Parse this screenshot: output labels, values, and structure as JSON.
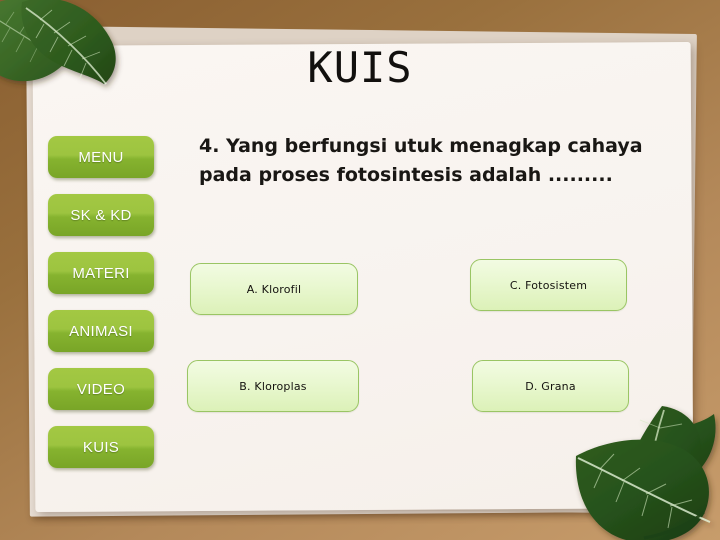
{
  "slide": {
    "title": "KUIS",
    "background_color": "#99703d",
    "paper_color": "#f8f3ef"
  },
  "sidebar": {
    "accent_color": "#8fbb36",
    "items": [
      {
        "label": "MENU",
        "name": "menu"
      },
      {
        "label": "SK & KD",
        "name": "sk-kd"
      },
      {
        "label": "MATERI",
        "name": "materi"
      },
      {
        "label": "ANIMASI",
        "name": "animasi"
      },
      {
        "label": "VIDEO",
        "name": "video"
      },
      {
        "label": "KUIS",
        "name": "kuis"
      }
    ]
  },
  "quiz": {
    "question_line_1": "4. Yang berfungsi utuk menagkap cahaya",
    "question_line_2": "pada proses fotosintesis  adalah .........",
    "option_color": "#e6f6cc",
    "option_border_color": "#9ac564",
    "options": [
      {
        "key": "A",
        "label": "A. Klorofil"
      },
      {
        "key": "B",
        "label": "B. Kloroplas"
      },
      {
        "key": "C",
        "label": "C. Fotosistem"
      },
      {
        "key": "D",
        "label": "D. Grana"
      }
    ]
  },
  "decorations": {
    "top_left_leaves": "leaf-cluster-icon",
    "bottom_right_leaves": "leaf-cluster-icon",
    "leaf_color": "#2e5c1e"
  }
}
